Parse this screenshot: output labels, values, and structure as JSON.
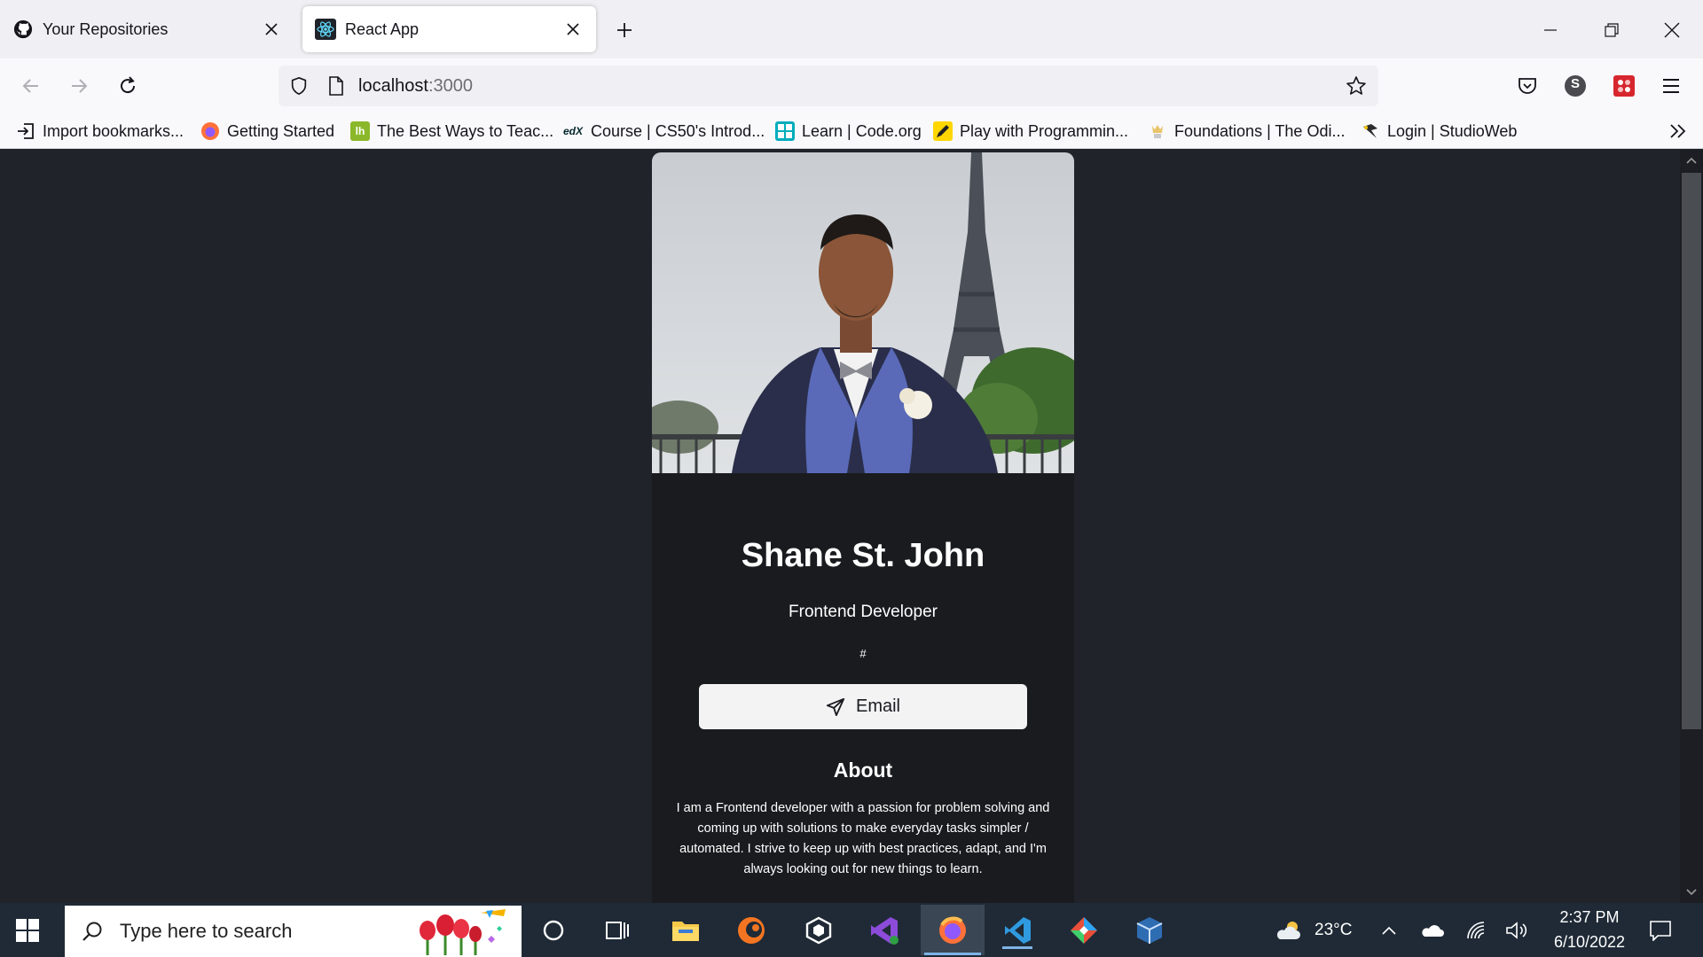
{
  "browser": {
    "tabs": [
      {
        "title": "Your Repositories",
        "icon": "github-icon",
        "active": false
      },
      {
        "title": "React App",
        "icon": "react-icon",
        "active": true
      }
    ],
    "url_host": "localhost",
    "url_port": ":3000",
    "bookmarks": [
      {
        "label": "Import bookmarks...",
        "icon": "import-icon"
      },
      {
        "label": "Getting Started",
        "icon": "firefox-icon"
      },
      {
        "label": "The Best Ways to Teac...",
        "icon": "lh-icon"
      },
      {
        "label": "Course | CS50's Introd...",
        "icon": "edx-icon"
      },
      {
        "label": "Learn | Code.org",
        "icon": "codeorg-icon"
      },
      {
        "label": "Play with Programmin...",
        "icon": "pencil-icon"
      },
      {
        "label": "Foundations | The Odi...",
        "icon": "odin-icon"
      },
      {
        "label": "Login | StudioWeb",
        "icon": "studioweb-icon"
      }
    ],
    "profile_initial": "S"
  },
  "profile": {
    "name": "Shane St. John",
    "role": "Frontend Developer",
    "link": "#",
    "email_label": "Email",
    "about_heading": "About",
    "about_text": "I am a Frontend developer with a passion for problem solving and coming up with solutions to make everyday tasks simpler / automated. I strive to keep up with best practices, adapt, and I'm always looking out for new things to learn."
  },
  "taskbar": {
    "search_placeholder": "Type here to search",
    "weather": "23°C",
    "time": "2:37 PM",
    "date": "6/10/2022"
  },
  "colors": {
    "page_bg": "#20232a",
    "card_bg": "#1a1b1f",
    "button_bg": "#f3f3f4",
    "taskbar_bg": "#1f2a36"
  }
}
